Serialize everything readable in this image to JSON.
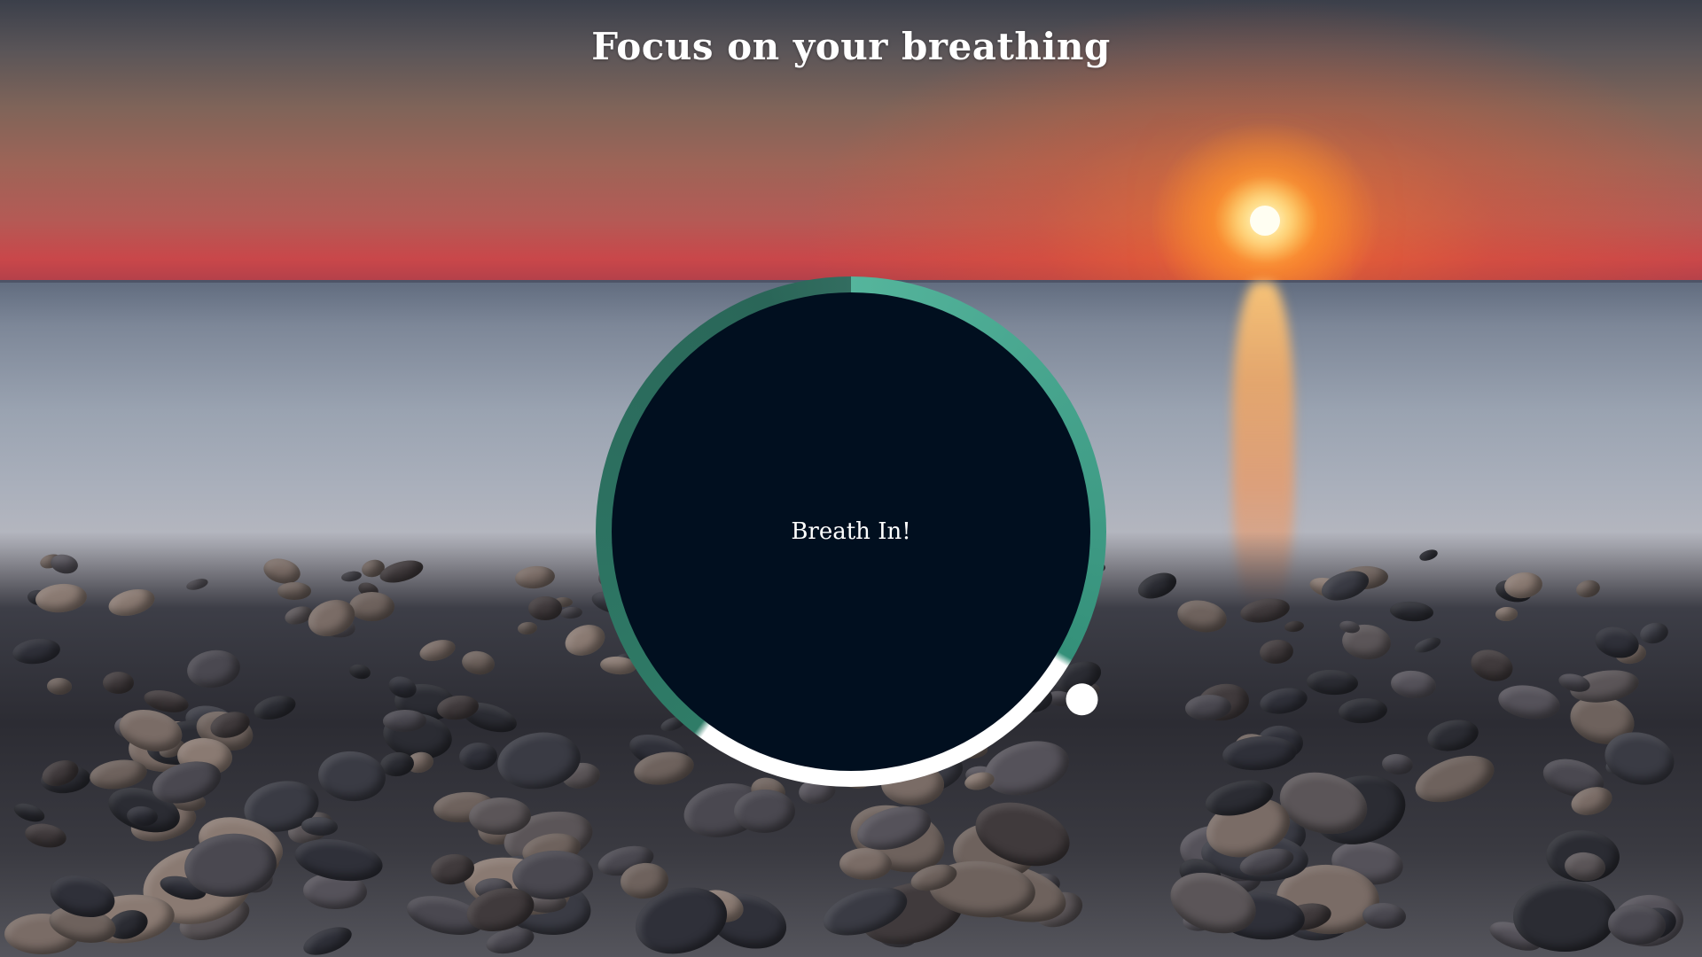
{
  "page": {
    "title": "Focus on your breathing"
  },
  "breathing": {
    "instruction": "Breath In!",
    "colors": {
      "inner_circle": "#010f1f",
      "ring_light": "#55b59c",
      "ring_dark": "#2a6658",
      "hold_segment": "#ffffff",
      "pointer": "#ffffff"
    }
  },
  "background": {
    "description_icon": "sunset-beach-pebbles-image"
  }
}
